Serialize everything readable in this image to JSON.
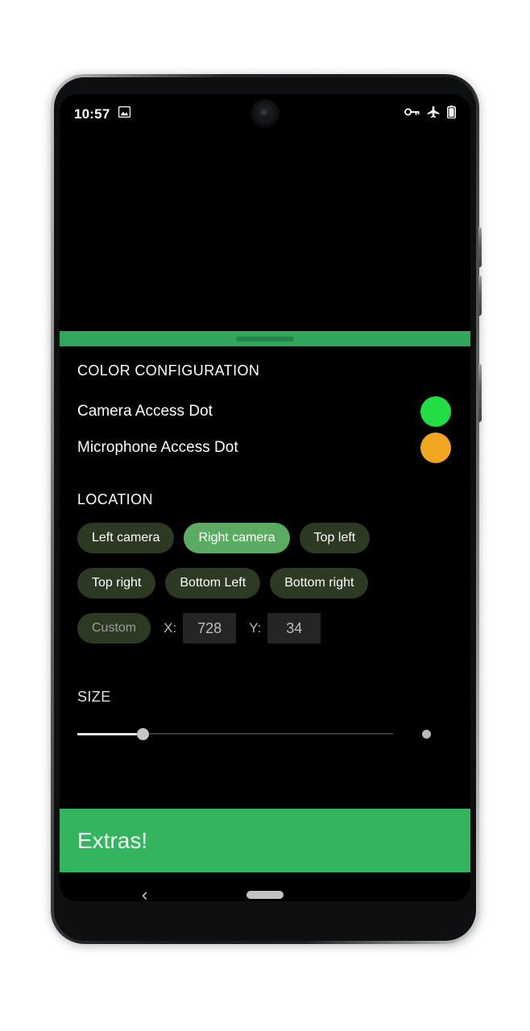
{
  "status_bar": {
    "clock": "10:57",
    "left_icons": [
      {
        "name": "image-notification-icon"
      }
    ],
    "right_icons": [
      {
        "name": "vpn-key-icon"
      },
      {
        "name": "airplane-mode-icon"
      },
      {
        "name": "battery-icon"
      }
    ]
  },
  "drag_bar": {
    "name": "drag-handle-bar",
    "color": "#2fa85c"
  },
  "sections": {
    "color_configuration": {
      "header": "COLOR CONFIGURATION",
      "rows": [
        {
          "label": "Camera Access Dot",
          "color": "#22dd44"
        },
        {
          "label": "Microphone Access Dot",
          "color": "#f3a622"
        }
      ]
    },
    "location": {
      "header": "LOCATION",
      "chips": [
        {
          "label": "Left camera",
          "selected": false,
          "disabled": false
        },
        {
          "label": "Right camera",
          "selected": true,
          "disabled": false
        },
        {
          "label": "Top left",
          "selected": false,
          "disabled": false
        },
        {
          "label": "Top right",
          "selected": false,
          "disabled": false
        },
        {
          "label": "Bottom Left",
          "selected": false,
          "disabled": false
        },
        {
          "label": "Bottom right",
          "selected": false,
          "disabled": false
        },
        {
          "label": "Custom",
          "selected": false,
          "disabled": true
        }
      ],
      "custom_coords": {
        "x_label": "X:",
        "x_value": "728",
        "y_label": "Y:",
        "y_value": "34"
      }
    },
    "size": {
      "header": "SIZE",
      "slider_percent": 19
    }
  },
  "extras": {
    "label": "Extras!",
    "background": "#33b45f"
  },
  "nav_bar": {
    "back_icon": "‹",
    "back_icon_name": "nav-back-icon",
    "home_pill_name": "nav-home-pill"
  },
  "theme": {
    "screen_background": "#000000",
    "accent_green": "#33b45f",
    "chip_unselected": "#2c3a24",
    "chip_selected": "#5cab62"
  }
}
